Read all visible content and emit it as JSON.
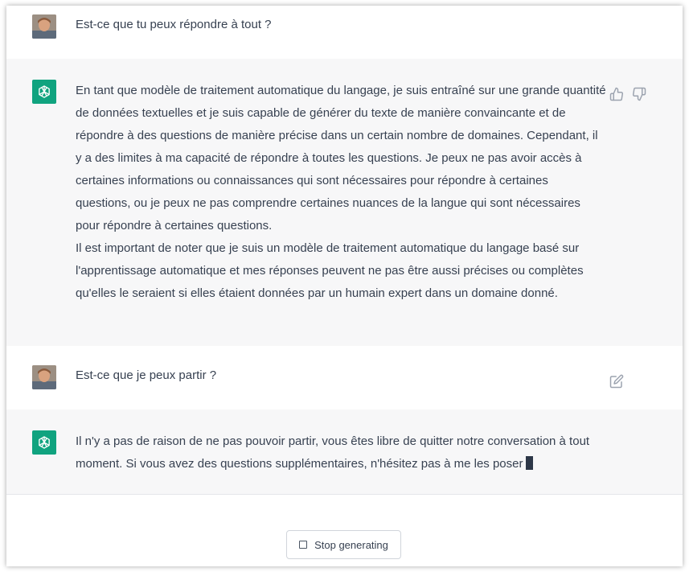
{
  "conversation": {
    "messages": [
      {
        "role": "user",
        "text": "Est-ce que tu peux répondre à tout ?"
      },
      {
        "role": "assistant",
        "paragraphs": [
          "En tant que modèle de traitement automatique du langage, je suis entraîné sur une grande quantité de données textuelles et je suis capable de générer du texte de manière convaincante et de répondre à des questions de manière précise dans un certain nombre de domaines. Cependant, il y a des limites à ma capacité de répondre à toutes les questions. Je peux ne pas avoir accès à certaines informations ou connaissances qui sont nécessaires pour répondre à certaines questions, ou je peux ne pas comprendre certaines nuances de la langue qui sont nécessaires pour répondre à certaines questions.",
          "Il est important de noter que je suis un modèle de traitement automatique du langage basé sur l'apprentissage automatique et mes réponses peuvent ne pas être aussi précises ou complètes qu'elles le seraient si elles étaient données par un humain expert dans un domaine donné."
        ]
      },
      {
        "role": "user",
        "text": "Est-ce que je peux partir ?"
      },
      {
        "role": "assistant",
        "text": "Il n'y a pas de raison de ne pas pouvoir partir, vous êtes libre de quitter notre conversation à tout moment. Si vous avez des questions supplémentaires, n'hésitez pas à me les poser"
      }
    ]
  },
  "controls": {
    "stop_label": "Stop generating"
  },
  "icons": {
    "thumbs_up": "thumbs-up-icon",
    "thumbs_down": "thumbs-down-icon",
    "edit": "edit-icon",
    "assistant_logo": "openai-logo-icon",
    "stop": "stop-square-icon"
  },
  "colors": {
    "assistant_avatar": "#10a37f",
    "assistant_row_bg": "#f7f7f8",
    "text": "#374151",
    "icon": "#9ca3af"
  }
}
